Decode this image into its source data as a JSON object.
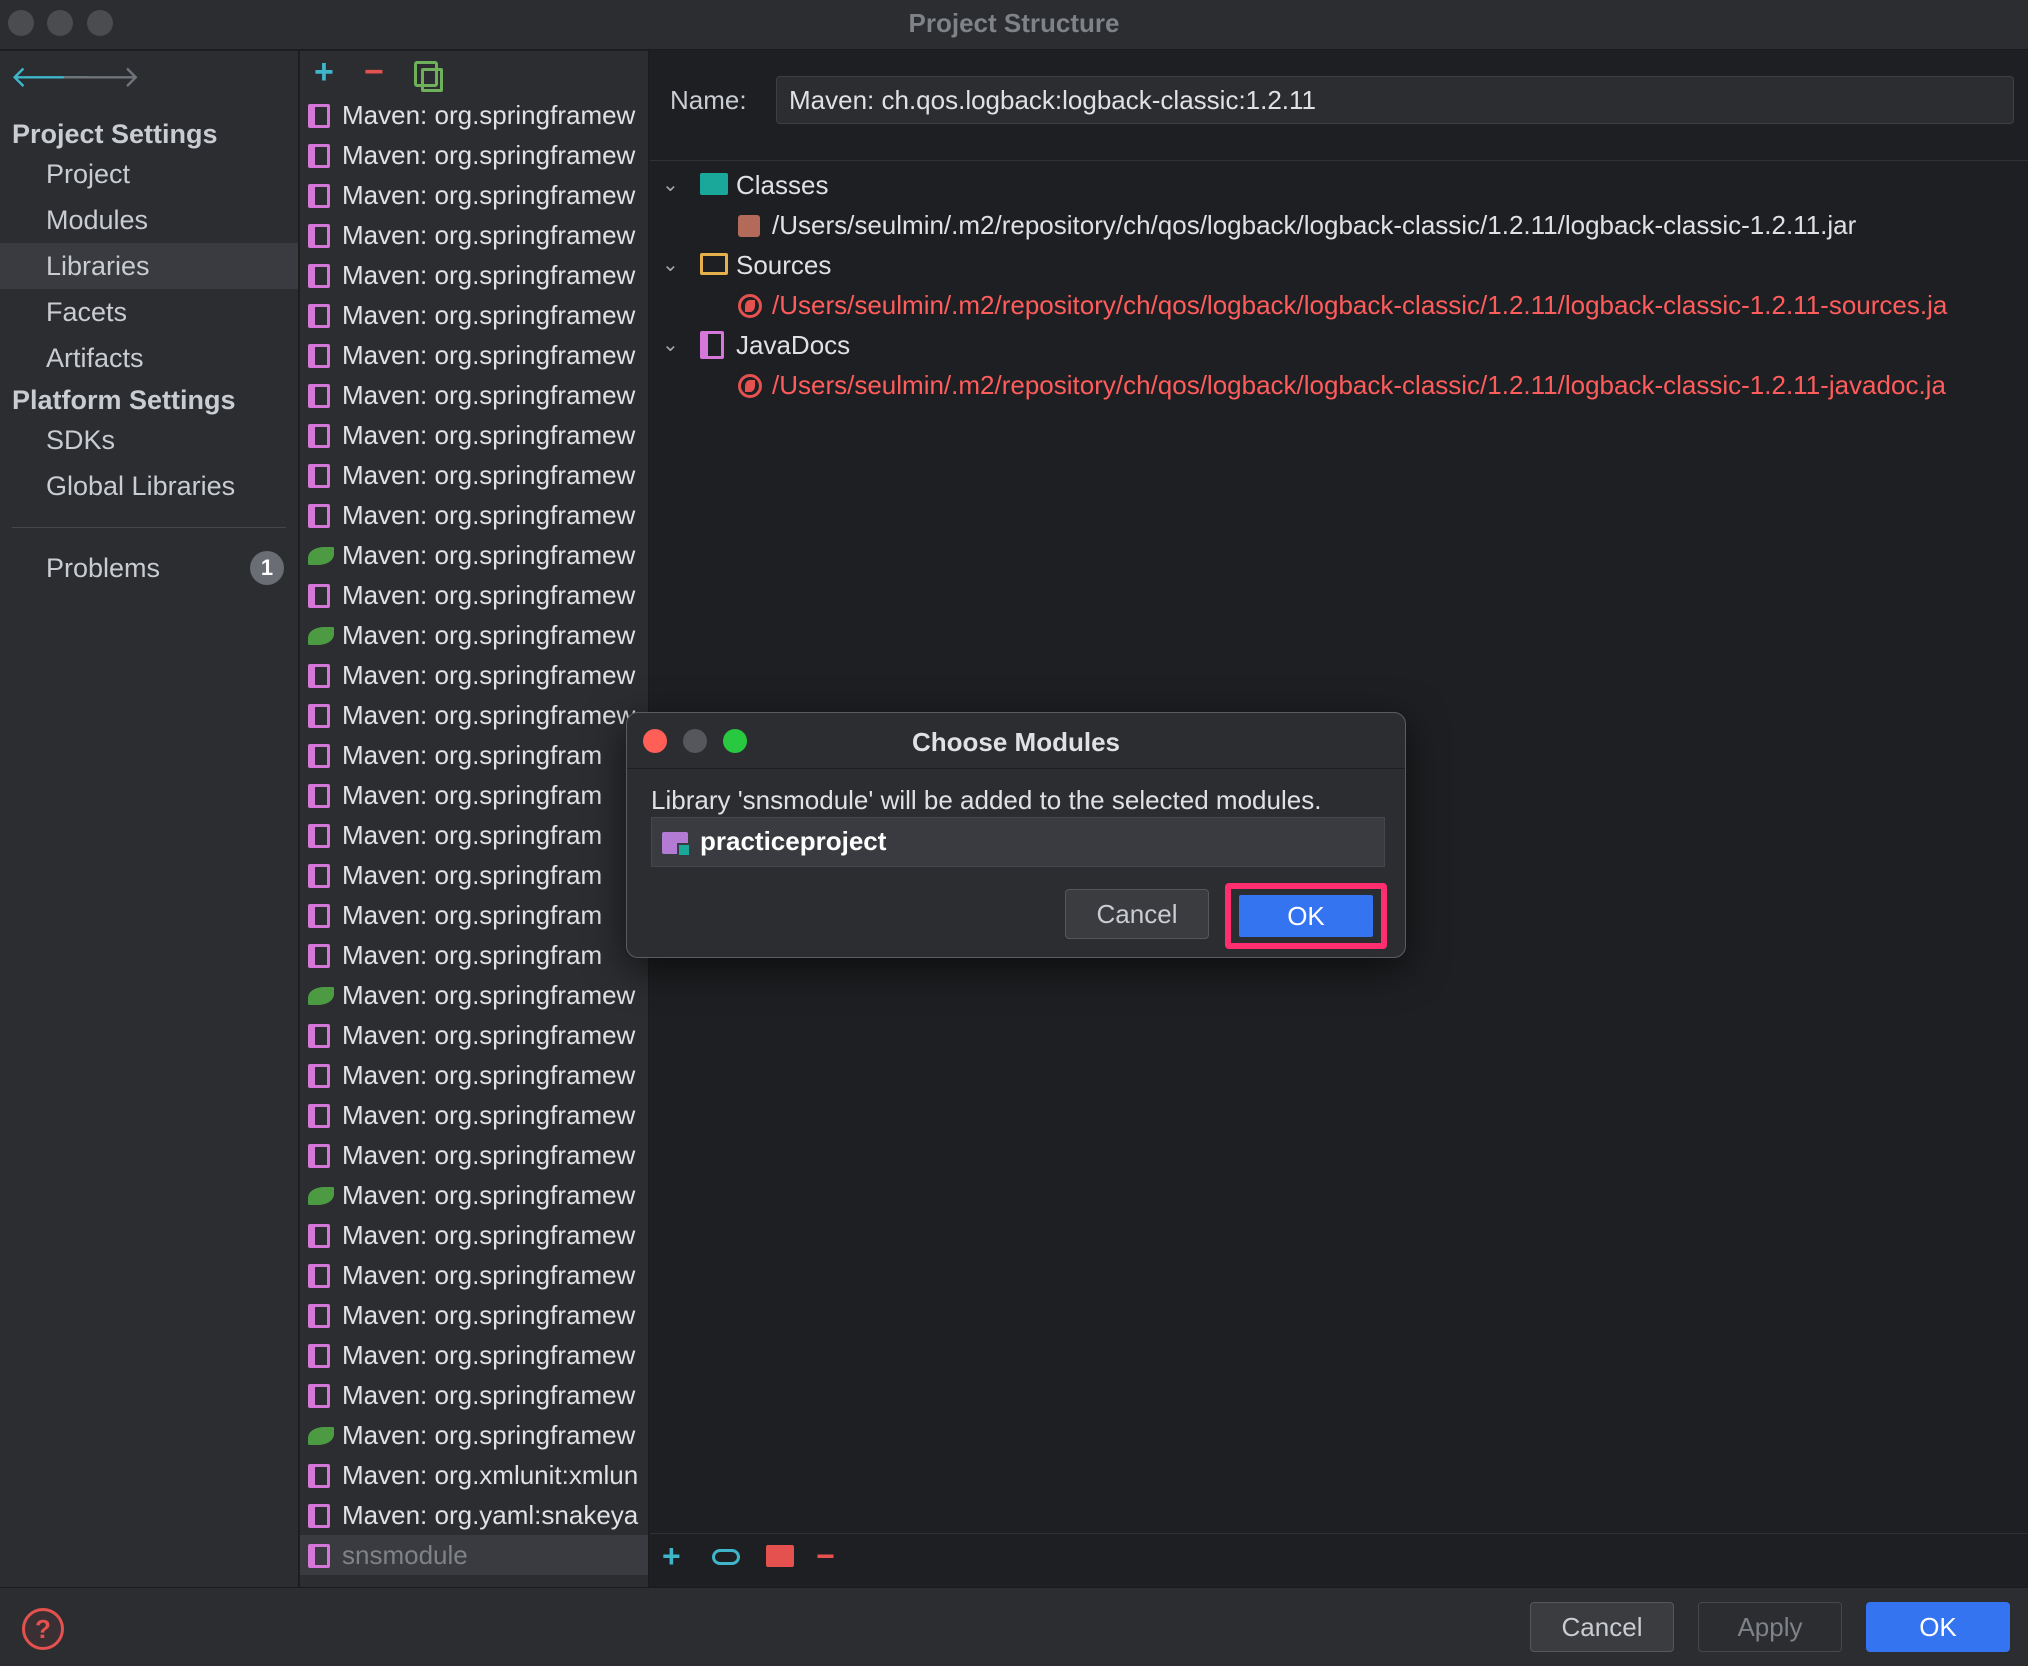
{
  "window": {
    "title": "Project Structure"
  },
  "sidebar": {
    "back_icon": "arrow-left-icon",
    "forward_icon": "arrow-right-icon",
    "project_settings_title": "Project Settings",
    "project_items": [
      "Project",
      "Modules",
      "Libraries",
      "Facets",
      "Artifacts"
    ],
    "platform_settings_title": "Platform Settings",
    "platform_items": [
      "SDKs",
      "Global Libraries"
    ],
    "problems_label": "Problems",
    "problems_count": "1",
    "selected_item": "Libraries"
  },
  "libraries": {
    "toolbar_icons": [
      "plus-icon",
      "minus-icon",
      "copy-icon"
    ],
    "items": [
      {
        "label": "Maven: org.springframew",
        "icon": "library-icon"
      },
      {
        "label": "Maven: org.springframew",
        "icon": "library-icon"
      },
      {
        "label": "Maven: org.springframew",
        "icon": "library-icon"
      },
      {
        "label": "Maven: org.springframew",
        "icon": "library-icon"
      },
      {
        "label": "Maven: org.springframew",
        "icon": "library-icon"
      },
      {
        "label": "Maven: org.springframew",
        "icon": "library-icon"
      },
      {
        "label": "Maven: org.springframew",
        "icon": "library-icon"
      },
      {
        "label": "Maven: org.springframew",
        "icon": "library-icon"
      },
      {
        "label": "Maven: org.springframew",
        "icon": "library-icon"
      },
      {
        "label": "Maven: org.springframew",
        "icon": "library-icon"
      },
      {
        "label": "Maven: org.springframew",
        "icon": "library-icon"
      },
      {
        "label": "Maven: org.springframew",
        "icon": "spring-icon"
      },
      {
        "label": "Maven: org.springframew",
        "icon": "library-icon"
      },
      {
        "label": "Maven: org.springframew",
        "icon": "spring-icon"
      },
      {
        "label": "Maven: org.springframew",
        "icon": "library-icon"
      },
      {
        "label": "Maven: org.springframew",
        "icon": "library-icon"
      },
      {
        "label": "Maven: org.springfram",
        "icon": "library-icon"
      },
      {
        "label": "Maven: org.springfram",
        "icon": "library-icon"
      },
      {
        "label": "Maven: org.springfram",
        "icon": "library-icon"
      },
      {
        "label": "Maven: org.springfram",
        "icon": "library-icon"
      },
      {
        "label": "Maven: org.springfram",
        "icon": "library-icon"
      },
      {
        "label": "Maven: org.springfram",
        "icon": "library-icon"
      },
      {
        "label": "Maven: org.springframew",
        "icon": "spring-icon"
      },
      {
        "label": "Maven: org.springframew",
        "icon": "library-icon"
      },
      {
        "label": "Maven: org.springframew",
        "icon": "library-icon"
      },
      {
        "label": "Maven: org.springframew",
        "icon": "library-icon"
      },
      {
        "label": "Maven: org.springframew",
        "icon": "library-icon"
      },
      {
        "label": "Maven: org.springframew",
        "icon": "spring-icon"
      },
      {
        "label": "Maven: org.springframew",
        "icon": "library-icon"
      },
      {
        "label": "Maven: org.springframew",
        "icon": "library-icon"
      },
      {
        "label": "Maven: org.springframew",
        "icon": "library-icon"
      },
      {
        "label": "Maven: org.springframew",
        "icon": "library-icon"
      },
      {
        "label": "Maven: org.springframew",
        "icon": "library-icon"
      },
      {
        "label": "Maven: org.springframew",
        "icon": "spring-icon"
      },
      {
        "label": "Maven: org.xmlunit:xmlun",
        "icon": "library-icon"
      },
      {
        "label": "Maven: org.yaml:snakeya",
        "icon": "library-icon"
      },
      {
        "label": "snsmodule",
        "icon": "library-icon",
        "selected": true
      }
    ]
  },
  "detail": {
    "name_label": "Name:",
    "name_value": "Maven: ch.qos.logback:logback-classic:1.2.11",
    "classes_label": "Classes",
    "classes_path": "/Users/seulmin/.m2/repository/ch/qos/logback/logback-classic/1.2.11/logback-classic-1.2.11.jar",
    "sources_label": "Sources",
    "sources_path": "/Users/seulmin/.m2/repository/ch/qos/logback/logback-classic/1.2.11/logback-classic-1.2.11-sources.ja",
    "javadocs_label": "JavaDocs",
    "javadocs_path": "/Users/seulmin/.m2/repository/ch/qos/logback/logback-classic/1.2.11/logback-classic-1.2.11-javadoc.ja",
    "toolbar_icons": [
      "plus-icon",
      "link-icon",
      "add-folder-icon",
      "minus-icon"
    ]
  },
  "dialog": {
    "title": "Choose Modules",
    "message": "Library 'snsmodule' will be added to the selected modules.",
    "module_name": "practiceproject",
    "cancel_label": "Cancel",
    "ok_label": "OK",
    "highlight_color": "#ff2e6e"
  },
  "footer": {
    "cancel_label": "Cancel",
    "apply_label": "Apply",
    "ok_label": "OK"
  },
  "colors": {
    "accent": "#3574f0",
    "error_path": "#ff5c5c",
    "teal": "#3fb5c9"
  }
}
